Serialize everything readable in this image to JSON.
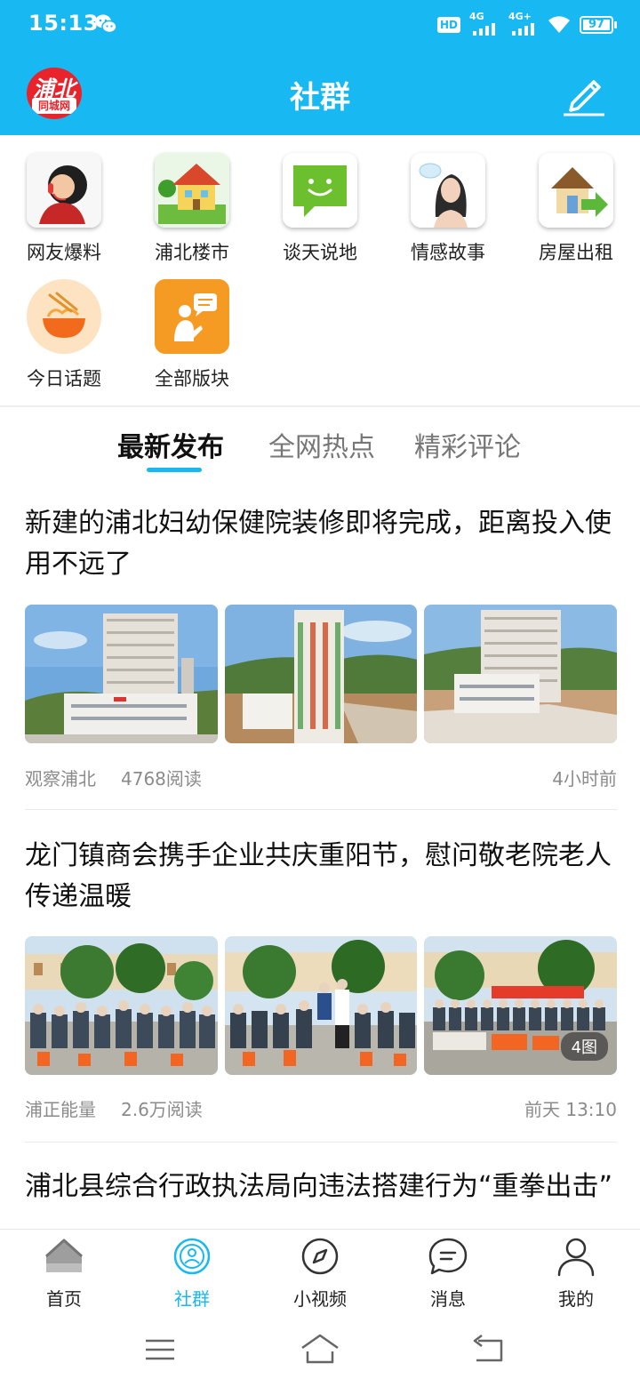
{
  "status_bar": {
    "time": "15:13",
    "hd_label": "HD",
    "signal1_label": "4G",
    "signal2_label": "4G+",
    "battery": "97"
  },
  "app_bar": {
    "logo_line1": "浦北",
    "logo_line2": "同城网",
    "title": "社群"
  },
  "categories": [
    {
      "label": "网友爆料",
      "icon": "headset-person-icon"
    },
    {
      "label": "浦北楼市",
      "icon": "house-icon"
    },
    {
      "label": "谈天说地",
      "icon": "chat-smile-icon"
    },
    {
      "label": "情感故事",
      "icon": "girl-portrait-icon"
    },
    {
      "label": "房屋出租",
      "icon": "house-arrow-icon"
    },
    {
      "label": "今日话题",
      "icon": "noodle-bowl-icon"
    },
    {
      "label": "全部版块",
      "icon": "speaker-person-icon"
    }
  ],
  "tabs": [
    {
      "label": "最新发布",
      "active": true
    },
    {
      "label": "全网热点",
      "active": false
    },
    {
      "label": "精彩评论",
      "active": false
    }
  ],
  "articles": [
    {
      "title": "新建的浦北妇幼保健院装修即将完成，距离投入使用不远了",
      "source": "观察浦北",
      "reads": "4768阅读",
      "time": "4小时前",
      "image_count_badge": ""
    },
    {
      "title": "龙门镇商会携手企业共庆重阳节，慰问敬老院老人传递温暖",
      "source": "浦正能量",
      "reads": "2.6万阅读",
      "time": "前天 13:10",
      "image_count_badge": "4图"
    },
    {
      "title": "浦北县综合行政执法局向违法搭建行为“重拳出击”"
    }
  ],
  "bottom_nav": [
    {
      "label": "首页",
      "icon": "home-icon",
      "active": false
    },
    {
      "label": "社群",
      "icon": "community-icon",
      "active": true
    },
    {
      "label": "小视频",
      "icon": "compass-icon",
      "active": false
    },
    {
      "label": "消息",
      "icon": "message-icon",
      "active": false
    },
    {
      "label": "我的",
      "icon": "person-icon",
      "active": false
    }
  ],
  "colors": {
    "brand_blue": "#18b8f2",
    "logo_red": "#e8232b",
    "meta_gray": "#8b8b8b"
  }
}
